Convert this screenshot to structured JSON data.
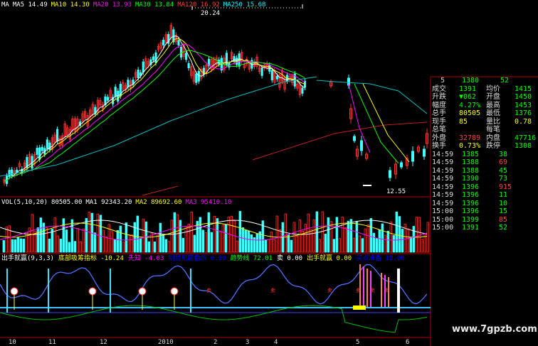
{
  "ma_legend": [
    {
      "text": "MA",
      "color": "#ffffff"
    },
    {
      "text": "MA5 14.49",
      "color": "#ffffff"
    },
    {
      "text": "MA10 14.30",
      "color": "#ffff00"
    },
    {
      "text": "MA20 13.93",
      "color": "#ff00ff"
    },
    {
      "text": "MA30 13.84",
      "color": "#00ff00"
    },
    {
      "text": "MA120 16.92",
      "color": "#ff4040"
    },
    {
      "text": "MA250 15.68",
      "color": "#00ffff"
    }
  ],
  "price_high_label": "20.24",
  "price_low_label": "12.55",
  "vol_legend": [
    {
      "text": "VOL(5,10,20)",
      "color": "#ffffff"
    },
    {
      "text": "80505.00",
      "color": "#ffffff"
    },
    {
      "text": "MA1 92343.20",
      "color": "#ffffff"
    },
    {
      "text": "MA2 89692.60",
      "color": "#ffff00"
    },
    {
      "text": "MA3 95410.10",
      "color": "#ff00ff"
    }
  ],
  "ind_legend": [
    {
      "text": "出手就赢(9,3,3)",
      "color": "#ffffff"
    },
    {
      "text": "底部吸筹指标 -10.24",
      "color": "#ffff00"
    },
    {
      "text": "先知 -4.03",
      "color": "#ff00ff"
    },
    {
      "text": "明显见底指示 0.00",
      "color": "#0000ff"
    },
    {
      "text": "趋势线 72.01",
      "color": "#00ff00"
    },
    {
      "text": "卖 0.00",
      "color": "#ffffff"
    },
    {
      "text": "出手就赢 0.00",
      "color": "#ffff00"
    },
    {
      "text": "买点准备 10.00",
      "color": "#0000ff"
    }
  ],
  "date_axis": [
    "10",
    "11",
    "12",
    "2010",
    "2",
    "3",
    "4",
    "5",
    "6"
  ],
  "quote_stub": {
    "a": "5",
    "b": "1380",
    "c": "52"
  },
  "quote_rows": [
    {
      "l1": "成交",
      "v1": "1391",
      "l2": "均价",
      "v2": "1415",
      "c1": "#00ff00",
      "c2": "#00ff00"
    },
    {
      "l1": "升跌",
      "v1": "▼062",
      "l2": "开盘",
      "v2": "1450",
      "c1": "#00ff00",
      "c2": "#00ff00"
    },
    {
      "l1": "幅度",
      "v1": "4.27%",
      "l2": "最高",
      "v2": "1453",
      "c1": "#00ff00",
      "c2": "#00ff00"
    },
    {
      "l1": "总手",
      "v1": "80505",
      "l2": "最低",
      "v2": "1376",
      "c1": "#ffff00",
      "c2": "#00ff00"
    },
    {
      "l1": "现手",
      "v1": "85",
      "l2": "量比",
      "v2": "0.78",
      "c1": "#ffff00",
      "c2": "#ffff00"
    },
    {
      "l1": "总笔",
      "v1": "",
      "l2": "每笔",
      "v2": "",
      "c1": "#ffff00",
      "c2": "#ffff00"
    },
    {
      "l1": "外盘",
      "v1": "32789",
      "l2": "内盘",
      "v2": "47716",
      "c1": "#ff4040",
      "c2": "#00ff00"
    },
    {
      "l1": "换手",
      "v1": "0.73%",
      "l2": "跌停",
      "v2": "1308",
      "c1": "#ffff00",
      "c2": "#00ff00"
    }
  ],
  "ticks": [
    {
      "t": "14:59",
      "p": "1385",
      "v": "38"
    },
    {
      "t": "14:59",
      "p": "1388",
      "v": "69"
    },
    {
      "t": "14:59",
      "p": "1388",
      "v": "45"
    },
    {
      "t": "14:59",
      "p": "1390",
      "v": "73"
    },
    {
      "t": "14:59",
      "p": "1396",
      "v": "915"
    },
    {
      "t": "14:59",
      "p": "1396",
      "v": "11"
    },
    {
      "t": "14:59",
      "p": "1396",
      "v": "10"
    },
    {
      "t": "15:00",
      "p": "1396",
      "v": "15"
    },
    {
      "t": "15:00",
      "p": "1399",
      "v": "85"
    },
    {
      "t": "15:00",
      "p": "1391",
      "v": "52"
    }
  ],
  "watermark": "www.7gpzb.com"
}
